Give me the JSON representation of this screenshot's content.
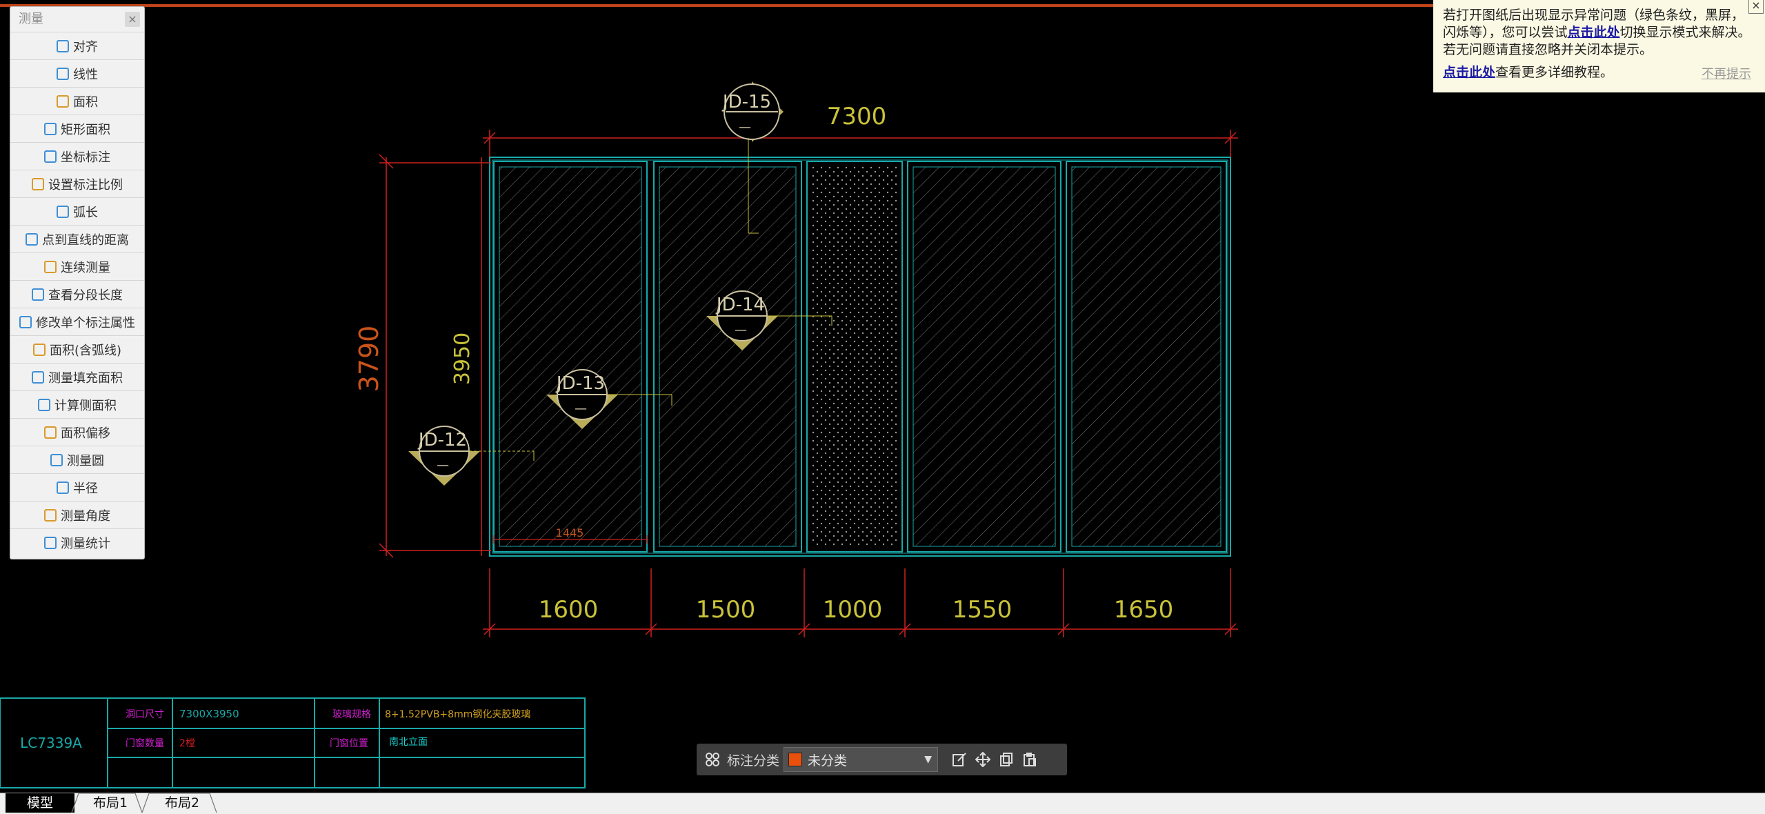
{
  "panel": {
    "title": "测量",
    "close_icon": "close-icon",
    "items": [
      {
        "label": "对齐",
        "icon": "align-measure-icon"
      },
      {
        "label": "线性",
        "icon": "linear-measure-icon"
      },
      {
        "label": "面积",
        "icon": "area-icon"
      },
      {
        "label": "矩形面积",
        "icon": "rect-area-icon"
      },
      {
        "label": "坐标标注",
        "icon": "coordinate-icon"
      },
      {
        "label": "设置标注比例",
        "icon": "scale-icon"
      },
      {
        "label": "弧长",
        "icon": "arc-length-icon"
      },
      {
        "label": "点到直线的距离",
        "icon": "point-line-distance-icon"
      },
      {
        "label": "连续测量",
        "icon": "continuous-measure-icon"
      },
      {
        "label": "查看分段长度",
        "icon": "segment-length-icon"
      },
      {
        "label": "修改单个标注属性",
        "icon": "edit-annotation-icon"
      },
      {
        "label": "面积(含弧线)",
        "icon": "arc-area-icon"
      },
      {
        "label": "测量填充面积",
        "icon": "fill-area-icon"
      },
      {
        "label": "计算侧面积",
        "icon": "side-area-icon"
      },
      {
        "label": "面积偏移",
        "icon": "area-offset-icon"
      },
      {
        "label": "测量圆",
        "icon": "circle-icon"
      },
      {
        "label": "半径",
        "icon": "radius-icon"
      },
      {
        "label": "测量角度",
        "icon": "angle-icon"
      },
      {
        "label": "测量统计",
        "icon": "statistics-icon"
      }
    ]
  },
  "notice": {
    "line1_a": "若打开图纸后出现显示异常问题（绿色条纹，黑屏，闪烁等），您可以尝试",
    "link1": "点击此处",
    "line1_b": "切换显示模式来解决。若无问题请直接忽略并关闭本提示。",
    "link2": "点击此处",
    "line2": "查看更多详细教程。",
    "dismiss": "不再提示",
    "close": "×"
  },
  "drawing": {
    "overall_width": "7300",
    "overall_height_outer": "3790",
    "overall_height_inner": "3950",
    "inner_dim": "1445",
    "segments": [
      "1600",
      "1500",
      "1000",
      "1550",
      "1650"
    ],
    "tags": [
      "JD-15",
      "JD-14",
      "JD-13",
      "JD-12"
    ],
    "tag_sub": "—"
  },
  "title_block": {
    "code": "LC7339A",
    "label_size": "洞口尺寸",
    "value_size": "7300X3950",
    "label_glass": "玻璃规格",
    "value_glass": "8+1.52PVB+8mm钢化夹胶玻璃",
    "label_qty": "门窗数量",
    "value_qty": "2樘",
    "label_pos": "门窗位置",
    "value_pos": "南北立面"
  },
  "toolbar": {
    "label": "标注分类",
    "selected": "未分类",
    "swatch_color": "#e8500c",
    "icons": [
      "grid-icon",
      "edit-icon",
      "move-icon",
      "copy-icon",
      "paste-icon"
    ]
  },
  "tabs": [
    "模型",
    "布局1",
    "布局2"
  ]
}
